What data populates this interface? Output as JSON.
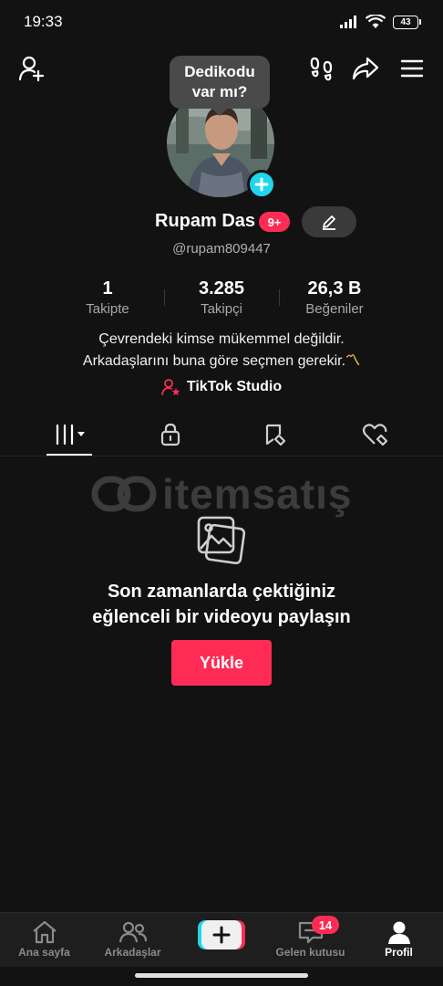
{
  "status": {
    "time": "19:33",
    "battery": "43"
  },
  "tooltip": {
    "line1": "Dedikodu",
    "line2": "var mı?"
  },
  "profile": {
    "name": "Rupam Das",
    "badge": "9+",
    "handle": "@rupam809447",
    "stats": [
      {
        "value": "1",
        "label": "Takipte"
      },
      {
        "value": "3.285",
        "label": "Takipçi"
      },
      {
        "value": "26,3 B",
        "label": "Beğeniler"
      }
    ],
    "bio_line1": "Çevrendeki kimse mükemmel değildir.",
    "bio_line2": "Arkadaşlarını buna göre seçmen gerekir.",
    "bio_emoji": "〽",
    "studio_label": "TikTok Studio"
  },
  "tabs": [
    "videos-grid-icon",
    "lock-icon",
    "saved-icon",
    "liked-icon"
  ],
  "watermark": {
    "text": "itemsatış"
  },
  "empty": {
    "title_line1": "Son zamanlarda çektiğiniz",
    "title_line2": "eğlenceli bir videoyu paylaşın",
    "button": "Yükle"
  },
  "nav": {
    "home": "Ana sayfa",
    "friends": "Arkadaşlar",
    "inbox": "Gelen kutusu",
    "inbox_badge": "14",
    "profile": "Profil"
  },
  "colors": {
    "accent": "#fe2c55",
    "cyan": "#20d5ec",
    "background": "#121212"
  }
}
